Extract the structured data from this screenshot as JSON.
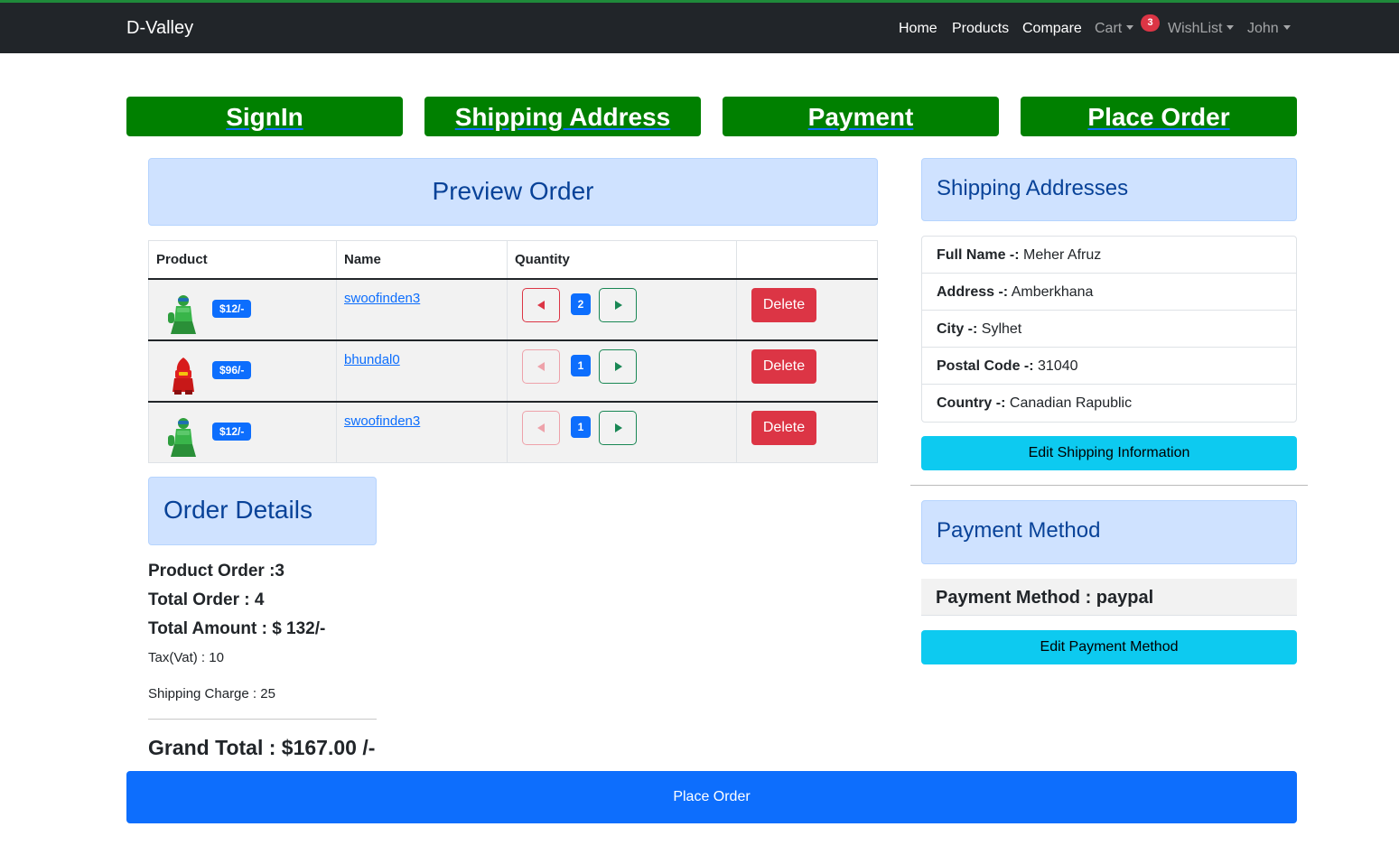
{
  "navbar": {
    "brand": "D-Valley",
    "links": [
      "Home",
      "Products",
      "Compare"
    ],
    "cart_label": "Cart",
    "cart_count": "3",
    "wishlist_label": "WishList",
    "user_label": "John"
  },
  "steps": [
    "SignIn",
    "Shipping Address",
    "Payment",
    "Place Order"
  ],
  "preview": {
    "title": "Preview Order",
    "headers": [
      "Product",
      "Name",
      "Quantity",
      ""
    ],
    "rows": [
      {
        "price": "$12/-",
        "name": "swoofinden3",
        "quantity": "2",
        "minus_disabled": false,
        "figure": "green",
        "delete_label": "Delete"
      },
      {
        "price": "$96/-",
        "name": "bhundal0",
        "quantity": "1",
        "minus_disabled": true,
        "figure": "red",
        "delete_label": "Delete"
      },
      {
        "price": "$12/-",
        "name": "swoofinden3",
        "quantity": "1",
        "minus_disabled": true,
        "figure": "green",
        "delete_label": "Delete"
      }
    ]
  },
  "order_details": {
    "title": "Order Details",
    "product_order": "Product Order :3",
    "total_order": "Total Order : 4",
    "total_amount": "Total Amount : $ 132/-",
    "tax": "Tax(Vat) : 10",
    "shipping_charge": "Shipping Charge : 25",
    "grand_total": "Grand Total : $167.00 /-"
  },
  "shipping": {
    "title": "Shipping Addresses",
    "fields": [
      {
        "label": "Full Name -:",
        "value": "Meher Afruz"
      },
      {
        "label": "Address -:",
        "value": "Amberkhana"
      },
      {
        "label": "City -:",
        "value": "Sylhet"
      },
      {
        "label": "Postal Code -:",
        "value": "31040"
      },
      {
        "label": "Country -:",
        "value": "Canadian Rapublic"
      }
    ],
    "edit_label": "Edit Shipping Information"
  },
  "payment": {
    "title": "Payment Method",
    "method_text": "Payment Method : paypal",
    "edit_label": "Edit Payment Method"
  },
  "place_order_label": "Place Order",
  "colors": {
    "navbar": "#212529",
    "step": "#008000",
    "primary": "#0d6efd",
    "danger": "#dc3545",
    "success": "#198754",
    "info": "#0dcaf0",
    "alert_bg": "#cfe2ff",
    "alert_text": "#084298"
  },
  "icons": [
    "caret-down-icon",
    "chevron-left-icon",
    "chevron-right-icon",
    "product-figure-icon"
  ]
}
